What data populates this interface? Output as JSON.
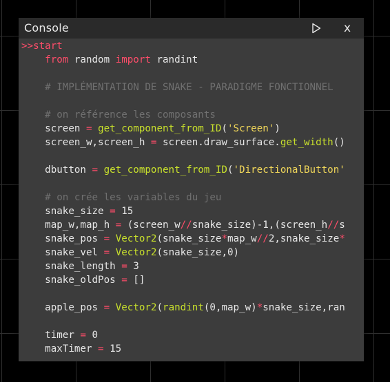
{
  "window": {
    "title": "Console",
    "close_label": "x"
  },
  "colors": {
    "background": "#000000",
    "window": "#3c3c3c",
    "titlebar": "#2a2a2a",
    "keyword": "#ff4d6a",
    "function": "#c8e02c",
    "string": "#f2d85a",
    "comment": "#707070",
    "text": "#e6e6e6"
  },
  "icons": {
    "run": "play-icon",
    "close": "close-icon"
  },
  "code": {
    "lines": [
      [
        {
          "t": "prompt",
          "v": ">>start"
        }
      ],
      [
        {
          "t": "txt",
          "v": "    "
        },
        {
          "t": "kw",
          "v": "from"
        },
        {
          "t": "txt",
          "v": " random "
        },
        {
          "t": "kw",
          "v": "import"
        },
        {
          "t": "txt",
          "v": " randint"
        }
      ],
      [],
      [
        {
          "t": "txt",
          "v": "    "
        },
        {
          "t": "cm",
          "v": "# IMPLÉMENTATION DE SNAKE - PARADIGME FONCTIONNEL"
        }
      ],
      [],
      [
        {
          "t": "txt",
          "v": "    "
        },
        {
          "t": "cm",
          "v": "# on référence les composants"
        }
      ],
      [
        {
          "t": "txt",
          "v": "    screen "
        },
        {
          "t": "op",
          "v": "="
        },
        {
          "t": "txt",
          "v": " "
        },
        {
          "t": "fn",
          "v": "get_component_from_ID"
        },
        {
          "t": "txt",
          "v": "("
        },
        {
          "t": "str",
          "v": "'Screen'"
        },
        {
          "t": "txt",
          "v": ")"
        }
      ],
      [
        {
          "t": "txt",
          "v": "    screen_w,screen_h "
        },
        {
          "t": "op",
          "v": "="
        },
        {
          "t": "txt",
          "v": " screen.draw_surface."
        },
        {
          "t": "fn",
          "v": "get_width"
        },
        {
          "t": "txt",
          "v": "()"
        }
      ],
      [],
      [
        {
          "t": "txt",
          "v": "    dbutton "
        },
        {
          "t": "op",
          "v": "="
        },
        {
          "t": "txt",
          "v": " "
        },
        {
          "t": "fn",
          "v": "get_component_from_ID"
        },
        {
          "t": "txt",
          "v": "("
        },
        {
          "t": "str",
          "v": "'DirectionalButton'"
        }
      ],
      [],
      [
        {
          "t": "txt",
          "v": "    "
        },
        {
          "t": "cm",
          "v": "# on crée les variables du jeu"
        }
      ],
      [
        {
          "t": "txt",
          "v": "    snake_size "
        },
        {
          "t": "op",
          "v": "="
        },
        {
          "t": "txt",
          "v": " 15"
        }
      ],
      [
        {
          "t": "txt",
          "v": "    map_w,map_h "
        },
        {
          "t": "op",
          "v": "="
        },
        {
          "t": "txt",
          "v": " (screen_w"
        },
        {
          "t": "op",
          "v": "//"
        },
        {
          "t": "txt",
          "v": "snake_size)-1,(screen_h"
        },
        {
          "t": "op",
          "v": "//"
        },
        {
          "t": "txt",
          "v": "s"
        }
      ],
      [
        {
          "t": "txt",
          "v": "    snake_pos "
        },
        {
          "t": "op",
          "v": "="
        },
        {
          "t": "txt",
          "v": " "
        },
        {
          "t": "fn",
          "v": "Vector2"
        },
        {
          "t": "txt",
          "v": "(snake_size"
        },
        {
          "t": "op",
          "v": "*"
        },
        {
          "t": "txt",
          "v": "map_w"
        },
        {
          "t": "op",
          "v": "//"
        },
        {
          "t": "txt",
          "v": "2,snake_size"
        },
        {
          "t": "op",
          "v": "*"
        }
      ],
      [
        {
          "t": "txt",
          "v": "    snake_vel "
        },
        {
          "t": "op",
          "v": "="
        },
        {
          "t": "txt",
          "v": " "
        },
        {
          "t": "fn",
          "v": "Vector2"
        },
        {
          "t": "txt",
          "v": "(snake_size,0)"
        }
      ],
      [
        {
          "t": "txt",
          "v": "    snake_length "
        },
        {
          "t": "op",
          "v": "="
        },
        {
          "t": "txt",
          "v": " 3"
        }
      ],
      [
        {
          "t": "txt",
          "v": "    snake_oldPos "
        },
        {
          "t": "op",
          "v": "="
        },
        {
          "t": "txt",
          "v": " []"
        }
      ],
      [],
      [
        {
          "t": "txt",
          "v": "    apple_pos "
        },
        {
          "t": "op",
          "v": "="
        },
        {
          "t": "txt",
          "v": " "
        },
        {
          "t": "fn",
          "v": "Vector2"
        },
        {
          "t": "txt",
          "v": "("
        },
        {
          "t": "fn",
          "v": "randint"
        },
        {
          "t": "txt",
          "v": "(0,map_w)"
        },
        {
          "t": "op",
          "v": "*"
        },
        {
          "t": "txt",
          "v": "snake_size,ran"
        }
      ],
      [],
      [
        {
          "t": "txt",
          "v": "    timer "
        },
        {
          "t": "op",
          "v": "="
        },
        {
          "t": "txt",
          "v": " 0"
        }
      ],
      [
        {
          "t": "txt",
          "v": "    maxTimer "
        },
        {
          "t": "op",
          "v": "="
        },
        {
          "t": "txt",
          "v": " 15"
        }
      ]
    ]
  }
}
